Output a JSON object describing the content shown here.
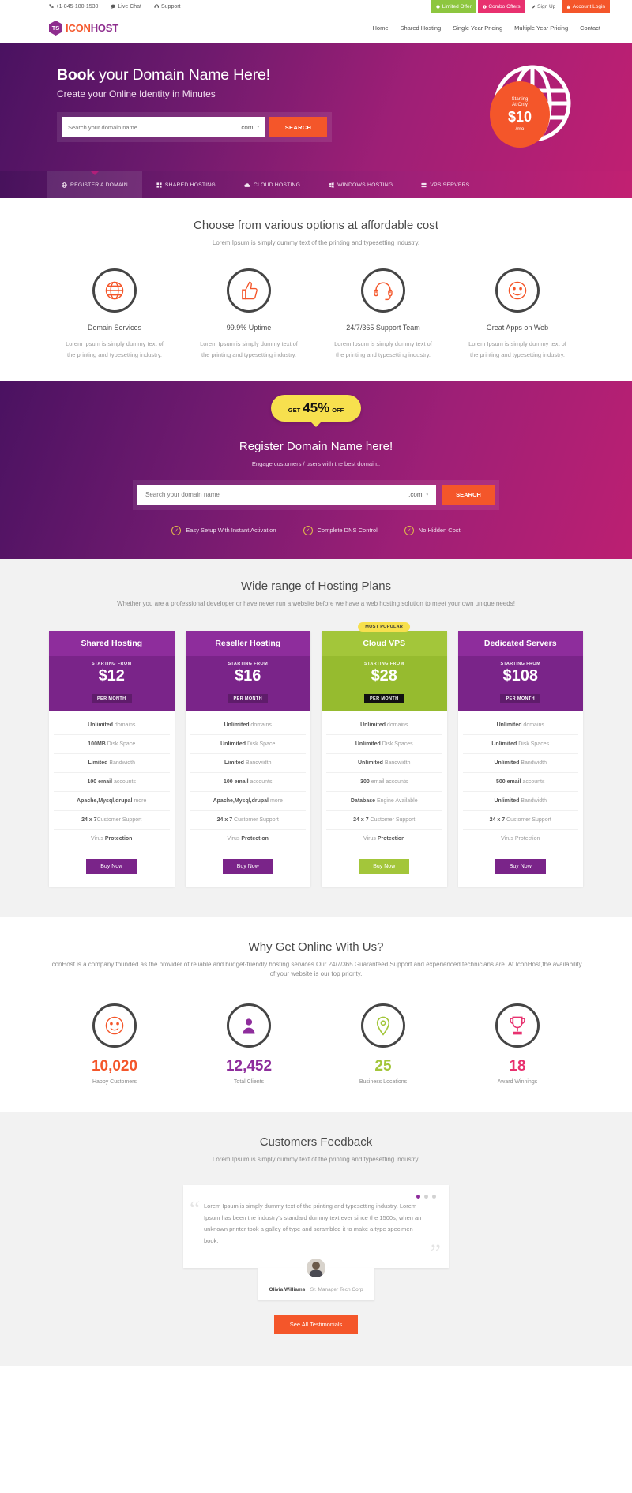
{
  "topbar": {
    "phone": "+1-845-180-1530",
    "live_chat": "Live Chat",
    "support": "Support",
    "limited_offer": "Limited Offer",
    "combo_offers": "Combo Offers",
    "sign_up": "Sign Up",
    "account_login": "Account Login",
    "colors": {
      "green": "#8dc63f",
      "pink": "#e8316f",
      "orange": "#f4562a"
    }
  },
  "header": {
    "logo_mark": "TS",
    "logo_icon": "ICON",
    "logo_host": "HOST",
    "nav": [
      {
        "label": "Home"
      },
      {
        "label": "Shared Hosting"
      },
      {
        "label": "Single Year Pricing"
      },
      {
        "label": "Multiple Year Pricing"
      },
      {
        "label": "Contact"
      }
    ]
  },
  "hero": {
    "title_bold": "Book",
    "title_rest": " your Domain Name Here!",
    "subtitle": "Create your Online Identity in Minutes",
    "search_placeholder": "Search your domain name",
    "search_value": "",
    "tld": ".com",
    "search_button": "SEARCH",
    "bubble_line1": "Starting",
    "bubble_line2": "At Only",
    "bubble_price": "$10",
    "bubble_period": "/mo"
  },
  "tabs": [
    {
      "label": "REGISTER A DOMAIN",
      "icon": "globe-icon",
      "active": true
    },
    {
      "label": "SHARED HOSTING",
      "icon": "grid-icon",
      "active": false
    },
    {
      "label": "CLOUD HOSTING",
      "icon": "cloud-icon",
      "active": false
    },
    {
      "label": "WINDOWS HOSTING",
      "icon": "windows-icon",
      "active": false
    },
    {
      "label": "VPS SERVERS",
      "icon": "server-icon",
      "active": false
    }
  ],
  "options": {
    "title": "Choose from various options at affordable cost",
    "subtitle": "Lorem Ipsum is simply dummy text of the printing and typesetting industry.",
    "features": [
      {
        "icon": "globe-icon",
        "title": "Domain Services",
        "desc": "Lorem Ipsum is simply dummy text of the printing and typesetting industry."
      },
      {
        "icon": "thumbs-up-icon",
        "title": "99.9% Uptime",
        "desc": "Lorem Ipsum is simply dummy text of the printing and typesetting industry."
      },
      {
        "icon": "headset-icon",
        "title": "24/7/365 Support Team",
        "desc": "Lorem Ipsum is simply dummy text of the printing and typesetting industry."
      },
      {
        "icon": "smiley-icon",
        "title": "Great Apps on Web",
        "desc": "Lorem Ipsum is simply dummy text of the printing and typesetting industry."
      }
    ]
  },
  "promo": {
    "ribbon_get": "GET",
    "ribbon_num": "45%",
    "ribbon_off": "OFF",
    "title": "Register Domain Name here!",
    "subtitle": "Engage customers / users with the best domain..",
    "search_placeholder": "Search your domain name",
    "search_value": "",
    "tld": ".com",
    "search_button": "SEARCH",
    "checks": [
      {
        "label": "Easy Setup With Instant Activation"
      },
      {
        "label": "Complete DNS Control"
      },
      {
        "label": "No Hidden Cost"
      }
    ]
  },
  "plans": {
    "title": "Wide range of Hosting Plans",
    "subtitle": "Whether you are a professional developer or have never run a website before we have a web hosting solution to meet your own unique needs!",
    "starting_from_label": "STARTING FROM",
    "per_month_label": "PER MONTH",
    "buy_label": "Buy Now",
    "items": [
      {
        "name": "Shared Hosting",
        "price": "$12",
        "badge": "",
        "highlight": false,
        "features": [
          {
            "strong": "Unlimited",
            "rest": " domains"
          },
          {
            "strong": "100MB",
            "rest": " Disk Space"
          },
          {
            "strong": "Limited",
            "rest": " Bandwidth"
          },
          {
            "strong": "100 email",
            "rest": " accounts"
          },
          {
            "strong": "Apache,Mysql,drupal",
            "rest": " more"
          },
          {
            "strong": "24 x 7",
            "rest": "Customer Support"
          },
          {
            "strong": "",
            "rest": "Virus ",
            "tail": "Protection"
          }
        ]
      },
      {
        "name": "Reseller Hosting",
        "price": "$16",
        "badge": "",
        "highlight": false,
        "features": [
          {
            "strong": "Unlimited",
            "rest": " domains"
          },
          {
            "strong": "Unlimited",
            "rest": " Disk Space"
          },
          {
            "strong": "Limited",
            "rest": " Bandwidth"
          },
          {
            "strong": "100 email",
            "rest": " accounts"
          },
          {
            "strong": "Apache,Mysql,drupal",
            "rest": " more"
          },
          {
            "strong": "24 x 7",
            "rest": " Customer Support"
          },
          {
            "strong": "",
            "rest": "Virus ",
            "tail": "Protection"
          }
        ]
      },
      {
        "name": "Cloud VPS",
        "price": "$28",
        "badge": "MOST POPULAR",
        "highlight": true,
        "features": [
          {
            "strong": "Unlimited",
            "rest": " domains"
          },
          {
            "strong": "Unlimited",
            "rest": " Disk Spaces"
          },
          {
            "strong": "Unlimited",
            "rest": " Bandwidth"
          },
          {
            "strong": "300",
            "rest": " email accounts"
          },
          {
            "strong": "Database",
            "rest": " Engine Available"
          },
          {
            "strong": "24 x 7",
            "rest": " Customer Support"
          },
          {
            "strong": "",
            "rest": "Virus ",
            "tail": "Protection"
          }
        ]
      },
      {
        "name": "Dedicated Servers",
        "price": "$108",
        "badge": "",
        "highlight": false,
        "features": [
          {
            "strong": "Unlimited",
            "rest": " domains"
          },
          {
            "strong": "Unlimited",
            "rest": " Disk Spaces"
          },
          {
            "strong": "Unlimited",
            "rest": " Bandwidth"
          },
          {
            "strong": "500 email",
            "rest": " accounts"
          },
          {
            "strong": "Unlimited",
            "rest": " Bandwidth"
          },
          {
            "strong": "24 x 7",
            "rest": " Customer Support"
          },
          {
            "strong": "",
            "rest": "Virus Protection",
            "tail": ""
          }
        ]
      }
    ]
  },
  "why": {
    "title": "Why Get Online With Us?",
    "subtitle": "IconHost is a company founded as the provider of reliable and budget-friendly hosting services.Our 24/7/365 Guaranteed Support and experienced technicians are. At IconHost,the availability of your website is our top priority.",
    "stats": [
      {
        "icon": "smiley-icon",
        "value": "10,020",
        "label": "Happy Customers",
        "color": "#f4562a"
      },
      {
        "icon": "user-icon",
        "value": "12,452",
        "label": "Total Clients",
        "color": "#8e2d9c"
      },
      {
        "icon": "map-pin-icon",
        "value": "25",
        "label": "Business Locations",
        "color": "#a3c63a"
      },
      {
        "icon": "trophy-icon",
        "value": "18",
        "label": "Award Winnings",
        "color": "#e8316f"
      }
    ]
  },
  "feedback": {
    "title": "Customers Feedback",
    "subtitle": "Lorem Ipsum is simply dummy text of the printing and typesetting industry.",
    "quote": "Lorem Ipsum is simply dummy text of the printing and typesetting industry. Lorem Ipsum has been the industry's standard dummy text ever since the 1500s, when an unknown printer took a galley of type and scrambled it to make a type specimen book.",
    "author_name": "Olivia Williams",
    "author_role": "Sr. Manager Tech Corp",
    "all_button": "See All Testimonials",
    "dots": [
      true,
      false,
      false
    ]
  }
}
